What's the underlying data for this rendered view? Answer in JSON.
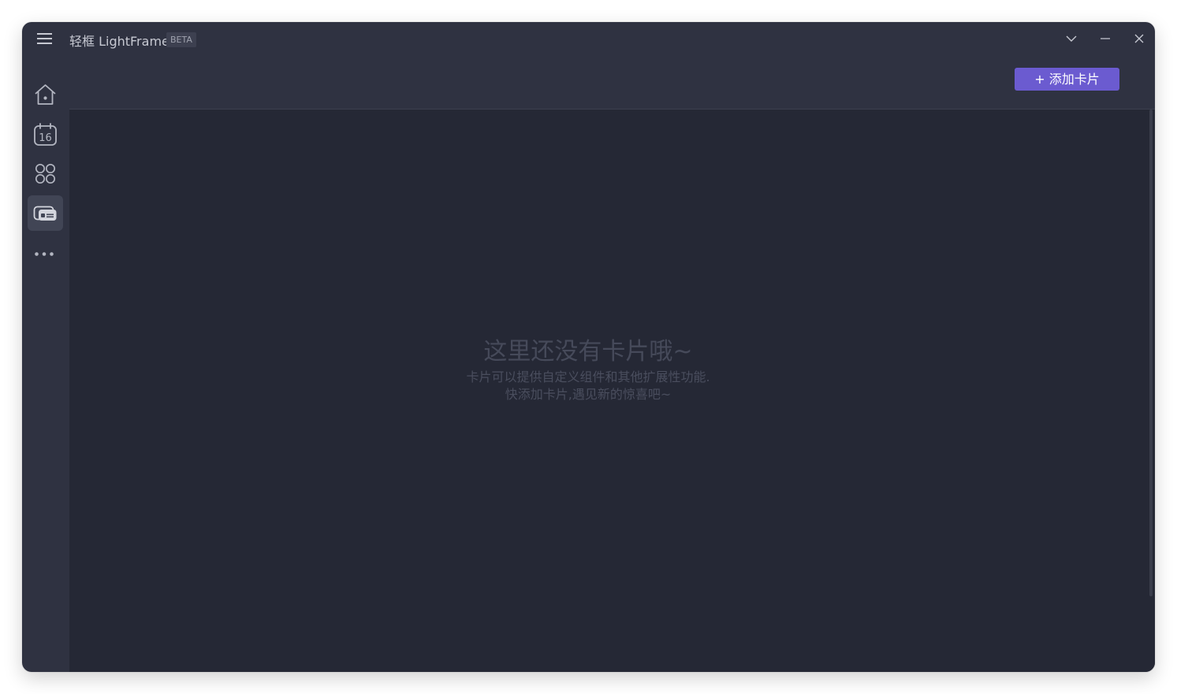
{
  "app": {
    "title": "轻框 LightFrame",
    "badge": "BETA"
  },
  "window_controls": {
    "collapse_icon": "chevron-down-icon",
    "minimize_icon": "minimize-icon",
    "close_icon": "close-icon"
  },
  "sidebar": {
    "items": [
      {
        "id": "home",
        "icon": "home-icon"
      },
      {
        "id": "calendar",
        "icon": "calendar-icon",
        "label": "16"
      },
      {
        "id": "apps",
        "icon": "apps-grid-icon"
      },
      {
        "id": "cards",
        "icon": "cards-icon",
        "active": true
      },
      {
        "id": "more",
        "icon": "more-icon"
      }
    ]
  },
  "toolbar": {
    "add_card_label": "+ 添加卡片"
  },
  "empty_state": {
    "title": "这里还没有卡片哦~",
    "line1": "卡片可以提供自定义组件和其他扩展性功能.",
    "line2": "快添加卡片,遇见新的惊喜吧~"
  },
  "colors": {
    "window_bg": "#2f3241",
    "content_bg": "#252835",
    "accent": "#6b5bd0"
  }
}
